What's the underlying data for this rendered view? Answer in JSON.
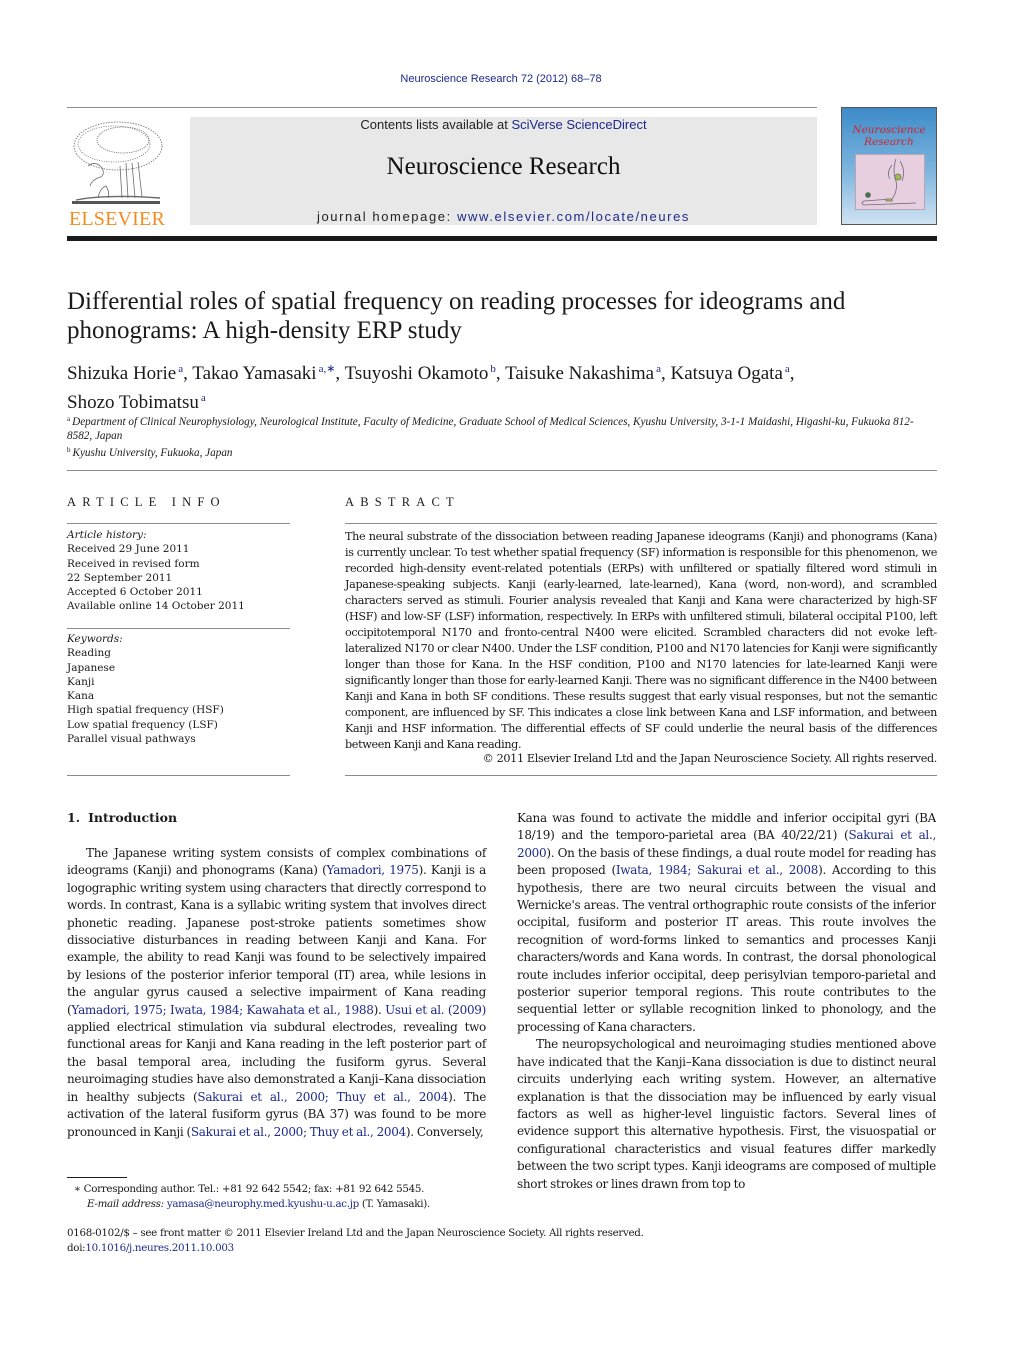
{
  "citation": "Neuroscience Research 72 (2012) 68–78",
  "header": {
    "publisher_wordmark": "ELSEVIER",
    "contents_prefix": "Contents lists available at ",
    "contents_link": "SciVerse ScienceDirect",
    "journal_name": "Neuroscience Research",
    "homepage_prefix": "journal homepage: ",
    "homepage_link": "www.elsevier.com/locate/neures",
    "cover_title_line1": "Neuroscience",
    "cover_title_line2": "Research"
  },
  "article": {
    "title": "Differential roles of spatial frequency on reading processes for ideograms and phonograms: A high-density ERP study",
    "authors": [
      {
        "name": "Shizuka Horie",
        "aff": "a",
        "sep": ", "
      },
      {
        "name": "Takao Yamasaki",
        "aff": "a,∗",
        "sep": ", "
      },
      {
        "name": "Tsuyoshi Okamoto",
        "aff": "b",
        "sep": ", "
      },
      {
        "name": "Taisuke Nakashima",
        "aff": "a",
        "sep": ", "
      },
      {
        "name": "Katsuya Ogata",
        "aff": "a",
        "sep": ","
      },
      {
        "name": "Shozo Tobimatsu",
        "aff": "a",
        "sep": ""
      }
    ],
    "affiliations": [
      {
        "key": "a",
        "text": "Department of Clinical Neurophysiology, Neurological Institute, Faculty of Medicine, Graduate School of Medical Sciences, Kyushu University, 3-1-1 Maidashi, Higashi-ku, Fukuoka 812-8582, Japan"
      },
      {
        "key": "b",
        "text": "Kyushu University, Fukuoka, Japan"
      }
    ]
  },
  "article_info": {
    "heading": "ARTICLE INFO",
    "history_label": "Article history:",
    "history": [
      "Received 29 June 2011",
      "Received in revised form",
      "22 September 2011",
      "Accepted 6 October 2011",
      "Available online 14 October 2011"
    ],
    "keywords_label": "Keywords:",
    "keywords": [
      "Reading",
      "Japanese",
      "Kanji",
      "Kana",
      "High spatial frequency (HSF)",
      "Low spatial frequency (LSF)",
      "Parallel visual pathways"
    ]
  },
  "abstract": {
    "heading": "ABSTRACT",
    "text": "The neural substrate of the dissociation between reading Japanese ideograms (Kanji) and phonograms (Kana) is currently unclear. To test whether spatial frequency (SF) information is responsible for this phenomenon, we recorded high-density event-related potentials (ERPs) with unfiltered or spatially filtered word stimuli in Japanese-speaking subjects. Kanji (early-learned, late-learned), Kana (word, non-word), and scrambled characters served as stimuli. Fourier analysis revealed that Kanji and Kana were characterized by high-SF (HSF) and low-SF (LSF) information, respectively. In ERPs with unfiltered stimuli, bilateral occipital P100, left occipitotemporal N170 and fronto-central N400 were elicited. Scrambled characters did not evoke left-lateralized N170 or clear N400. Under the LSF condition, P100 and N170 latencies for Kanji were significantly longer than those for Kana. In the HSF condition, P100 and N170 latencies for late-learned Kanji were significantly longer than those for early-learned Kanji. There was no significant difference in the N400 between Kanji and Kana in both SF conditions. These results suggest that early visual responses, but not the semantic component, are influenced by SF. This indicates a close link between Kana and LSF information, and between Kanji and HSF information. The differential effects of SF could underlie the neural basis of the differences between Kanji and Kana reading.",
    "copyright": "© 2011 Elsevier Ireland Ltd and the Japan Neuroscience Society. All rights reserved."
  },
  "body": {
    "section_number": "1.",
    "section_title": "Introduction",
    "p1": {
      "t1": "The Japanese writing system consists of complex combinations of ideograms (Kanji) and phonograms (Kana) (",
      "r1": "Yamadori, 1975",
      "t2": "). Kanji is a logographic writing system using characters that directly correspond to words. In contrast, Kana is a syllabic writing system that involves direct phonetic reading. Japanese post-stroke patients sometimes show dissociative disturbances in reading between Kanji and Kana. For example, the ability to read Kanji was found to be selectively impaired by lesions of the posterior inferior temporal (IT) area, while lesions in the angular gyrus caused a selective impairment of Kana reading (",
      "r2": "Yamadori, 1975; Iwata, 1984; Kawahata et al., 1988",
      "t3": "). ",
      "r3": "Usui et al. (2009)",
      "t4": " applied electrical stimulation via subdural electrodes, revealing two functional areas for Kanji and Kana reading in the left posterior part of the basal temporal area, including the fusiform gyrus. Several neuroimaging studies have also demonstrated a Kanji–Kana dissociation in healthy subjects (",
      "r4": "Sakurai et al., 2000; Thuy et al., 2004",
      "t5": "). The activation of the lateral fusiform gyrus (BA 37) was found to be more pronounced in Kanji (",
      "r5": "Sakurai et al., 2000; Thuy et al., 2004",
      "t6": "). Conversely, Kana was found to activate the middle and inferior occipital gyri (BA 18/19) and the temporo-parietal area (BA 40/22/21) (",
      "r6": "Sakurai et al., 2000",
      "t7": "). On the basis of these findings, a dual route model for reading has been proposed (",
      "r7": "Iwata, 1984; Sakurai et al., 2008",
      "t8": "). According to this hypothesis, there are two neural circuits between the visual and Wernicke's areas. The ventral orthographic route consists of the inferior occipital, fusiform and posterior IT areas. This route involves the recognition of word-forms linked to semantics and processes Kanji characters/words and Kana words. In contrast, the dorsal phonological route includes inferior occipital, deep perisylvian temporo-parietal and posterior superior temporal regions. This route contributes to the sequential letter or syllable recognition linked to phonology, and the processing of Kana characters."
    },
    "p2": "The neuropsychological and neuroimaging studies mentioned above have indicated that the Kanji–Kana dissociation is due to distinct neural circuits underlying each writing system. However, an alternative explanation is that the dissociation may be influenced by early visual factors as well as higher-level linguistic factors. Several lines of evidence support this alternative hypothesis. First, the visuospatial or configurational characteristics and visual features differ markedly between the two script types. Kanji ideograms are composed of multiple short strokes or lines drawn from top to"
  },
  "footnotes": {
    "corresponding": "∗ Corresponding author. Tel.: +81 92 642 5542; fax: +81 92 642 5545.",
    "email_label": "E-mail address: ",
    "email": "yamasa@neurophy.med.kyushu-u.ac.jp",
    "email_suffix": " (T. Yamasaki).",
    "front_matter": "0168-0102/$ – see front matter © 2011 Elsevier Ireland Ltd and the Japan Neuroscience Society. All rights reserved.",
    "doi_prefix": "doi:",
    "doi": "10.1016/j.neures.2011.10.003"
  },
  "colors": {
    "link": "#1d2a8a",
    "elsevier_orange": "#f28c1e",
    "header_box": "#e8e8e9",
    "cover_title": "#d2232a"
  }
}
